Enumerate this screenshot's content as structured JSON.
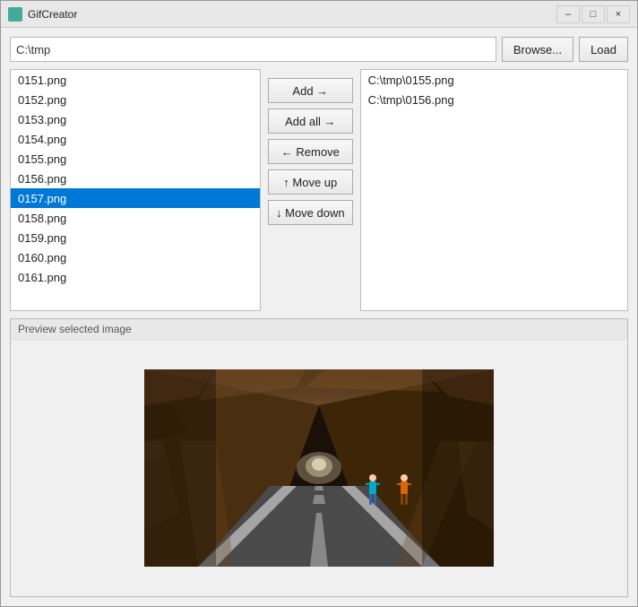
{
  "window": {
    "title": "GifCreator",
    "min_label": "–",
    "max_label": "□",
    "close_label": "×"
  },
  "toolbar": {
    "path_value": "C:\\tmp",
    "browse_label": "Browse...",
    "load_label": "Load"
  },
  "file_list": {
    "items": [
      "0151.png",
      "0152.png",
      "0153.png",
      "0154.png",
      "0155.png",
      "0156.png",
      "0157.png",
      "0158.png",
      "0159.png",
      "0160.png",
      "0161.png"
    ],
    "selected_index": 6
  },
  "middle_buttons": {
    "add_label": "Add →",
    "add_all_label": "Add all →",
    "remove_label": "← Remove",
    "move_up_label": "↑ Move up",
    "move_down_label": "↓ Move down"
  },
  "added_list": {
    "items": [
      "C:\\tmp\\0155.png",
      "C:\\tmp\\0156.png"
    ]
  },
  "preview": {
    "label": "Preview selected image"
  }
}
